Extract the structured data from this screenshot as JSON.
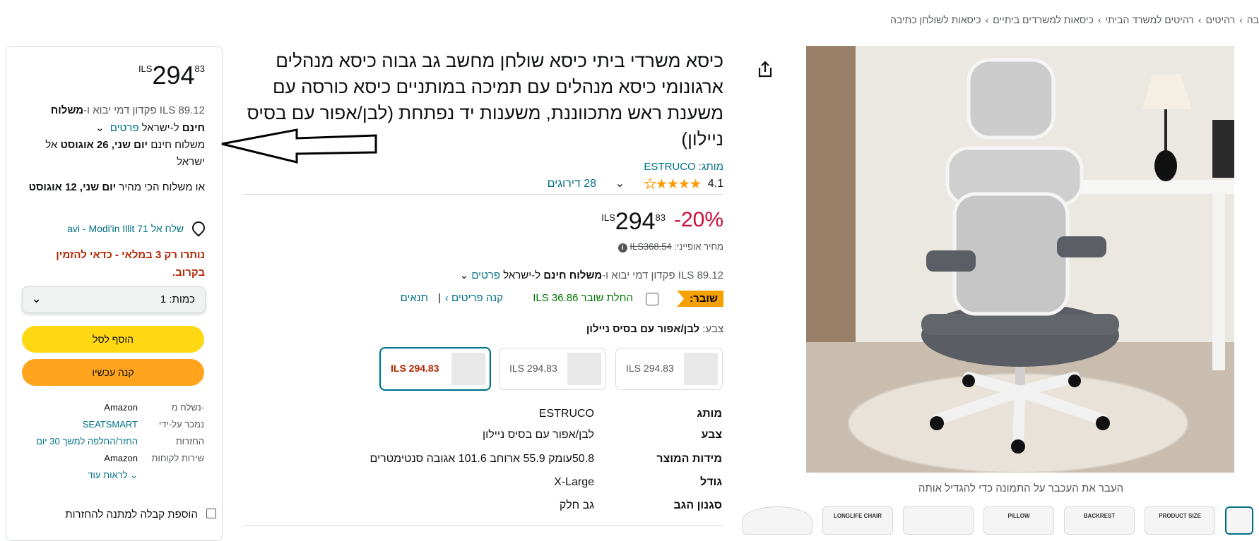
{
  "breadcrumb": [
    "חזרה לתוצאות",
    "רהיטים",
    "רהיטים למשרד הביתי",
    "כיסאות למשרדים ביתיים",
    "כיסאות לשולחן כתיבה"
  ],
  "breadcrumb_first_partial": "בה",
  "title": "כיסא משרדי ביתי כיסא שולחן מחשב גב גבוה כיסא מנהלים ארגונומי כיסא מנהלים עם תמיכה במותניים כיסא כורסה עם משענת ראש מתכווננת, משענות יד נפתחת (לבן/אפור עם בסיס ניילון)",
  "brand": {
    "label": "מותג:",
    "value": "ESTRUCO"
  },
  "rating": {
    "value": "4.1",
    "count": "28 דירוגים"
  },
  "price": {
    "discount": "-20%",
    "currency": "ILS",
    "whole": "294",
    "fraction": "83",
    "list_label": "מחיר אופייני:",
    "list_price": "ILS368.54"
  },
  "shipping": {
    "deposit": "ILS 89.12 פקדון דמי יבוא ו-",
    "free": "משלוח חינם",
    "to": " ל-ישראל ",
    "details": "פרטים"
  },
  "coupon": {
    "badge": "שובר:",
    "apply": "החלת שובר ILS 36.86",
    "shop": "קנה פריטים ›",
    "sep": "|",
    "terms": "תנאים"
  },
  "color": {
    "label": "צבע:",
    "value": "לבן/אפור עם בסיס ניילון"
  },
  "swatches": [
    {
      "price": "ILS 294.83"
    },
    {
      "price": "ILS 294.83"
    },
    {
      "price": "ILS 294.83"
    }
  ],
  "specs": [
    {
      "k": "מותג",
      "v": "ESTRUCO"
    },
    {
      "k": "צבע",
      "v": "לבן/אפור עם בסיס ניילון"
    },
    {
      "k": "מידות המוצר",
      "v": "50.8עומק 55.9 ארוחב 101.6 אגובה סנטימטרים"
    },
    {
      "k": "גודל",
      "v": "X-Large"
    },
    {
      "k": "סגנון הגב",
      "v": "גב חלק"
    }
  ],
  "buybox": {
    "currency": "ILS",
    "whole": "294",
    "fraction": "83",
    "deposit": "ILS 89.12 פקדון דמי יבוא ו-",
    "free_ship": "משלוח",
    "free_ship2": "חינם",
    "to": " ל-ישראל ",
    "details": "פרטים",
    "delivery_pre": "משלוח חינם ",
    "delivery_date": "יום שני, 26 אוגוסט",
    "delivery_post": " אל ישראל",
    "fast_pre": "או משלוח הכי מהיר ",
    "fast_date": "יום שני, 12 אוגוסט",
    "address": "שלח אל avi - Modi'in Illit 71",
    "stock": "נותרו רק 3 במלאי - כדאי להזמין בקרוב.",
    "qty_label": "כמות:",
    "qty_value": "1",
    "add_to_cart": "הוסף לסל",
    "buy_now": "קנה עכשיו",
    "info": [
      {
        "k": "נשלח מ-",
        "v": "Amazon"
      },
      {
        "k": "נמכר על-ידי",
        "v": "SEATSMART"
      },
      {
        "k": "החזרות",
        "v": "החזר/החלפה למשך 30 יום"
      },
      {
        "k": "שירות לקוחות",
        "v": "Amazon"
      }
    ],
    "see_more": "לראות עוד",
    "gift": "הוספת קבלה למתנה להחזרות"
  },
  "image_hint": "העבר את העכבר על התמונה כדי להגדיל אותה",
  "thumb_labels": [
    "",
    "LONGLIFE CHAIR",
    "",
    "PILLOW",
    "BACKREST",
    "PRODUCT SIZE",
    ""
  ],
  "colors": {
    "link": "#007185",
    "price_red": "#cc0c39",
    "cart_yellow": "#ffd814",
    "buy_orange": "#ffa41c",
    "coupon_orange": "#f7a100",
    "stock_red": "#b12704"
  }
}
